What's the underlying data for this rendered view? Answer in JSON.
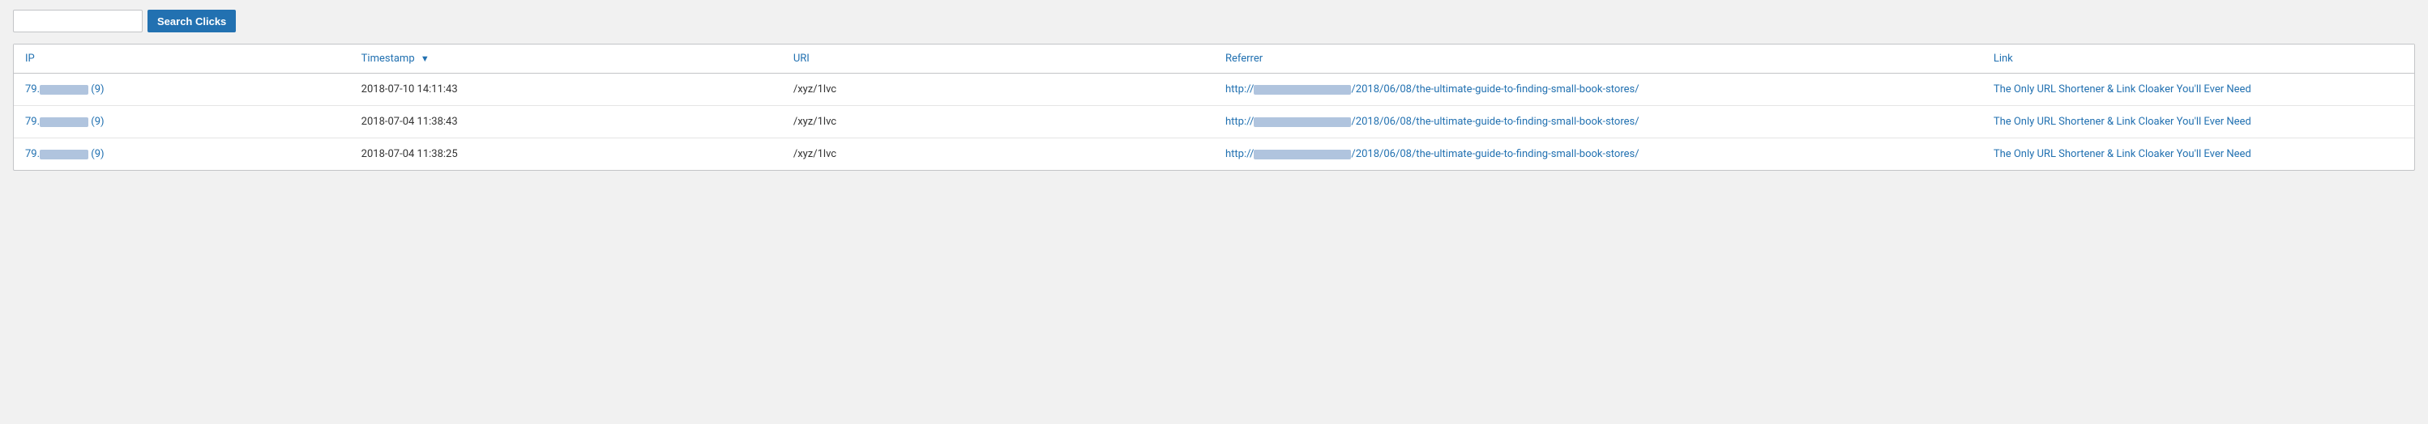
{
  "searchBar": {
    "inputPlaceholder": "",
    "buttonLabel": "Search Clicks"
  },
  "table": {
    "columns": [
      {
        "key": "ip",
        "label": "IP",
        "sortable": false
      },
      {
        "key": "timestamp",
        "label": "Timestamp",
        "sortable": true,
        "sorted": "desc"
      },
      {
        "key": "uri",
        "label": "URI",
        "sortable": false
      },
      {
        "key": "referrer",
        "label": "Referrer",
        "sortable": false
      },
      {
        "key": "link",
        "label": "Link",
        "sortable": false
      }
    ],
    "rows": [
      {
        "ip_prefix": "79.",
        "ip_blurred": true,
        "ip_count": "(9)",
        "timestamp": "2018-07-10 14:11:43",
        "uri": "/xyz/1lvc",
        "referrer_prefix": "http://",
        "referrer_suffix": "/2018/06/08/the-ultimate-guide-to-finding-small-book-stores/",
        "link": "The Only URL Shortener & Link Cloaker You'll Ever Need"
      },
      {
        "ip_prefix": "79.",
        "ip_blurred": true,
        "ip_count": "(9)",
        "timestamp": "2018-07-04 11:38:43",
        "uri": "/xyz/1lvc",
        "referrer_prefix": "http://",
        "referrer_suffix": "/2018/06/08/the-ultimate-guide-to-finding-small-book-stores/",
        "link": "The Only URL Shortener & Link Cloaker You'll Ever Need"
      },
      {
        "ip_prefix": "79.",
        "ip_blurred": true,
        "ip_count": "(9)",
        "timestamp": "2018-07-04 11:38:25",
        "uri": "/xyz/1lvc",
        "referrer_prefix": "http://",
        "referrer_suffix": "/2018/06/08/the-ultimate-guide-to-finding-small-book-stores/",
        "link": "The Only URL Shortener & Link Cloaker You'll Ever Need"
      }
    ]
  }
}
